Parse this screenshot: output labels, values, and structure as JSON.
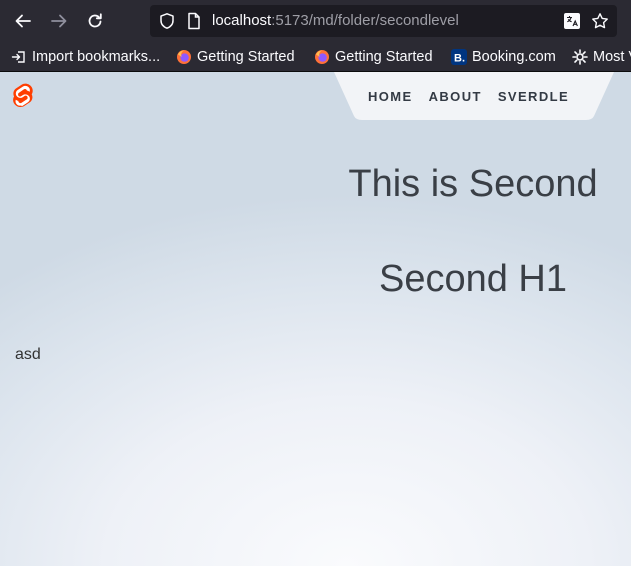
{
  "browser": {
    "url_host": "localhost",
    "url_path": ":5173/md/folder/secondlevel",
    "icons": [
      "back-arrow-icon",
      "forward-arrow-icon",
      "reload-icon",
      "shield-icon",
      "page-icon",
      "translate-icon",
      "star-icon"
    ],
    "bookmarks": [
      {
        "label": "Import bookmarks...",
        "icon": "import-icon"
      },
      {
        "label": "Getting Started",
        "icon": "firefox-icon"
      },
      {
        "label": "Getting Started",
        "icon": "firefox-icon"
      },
      {
        "label": "Booking.com",
        "icon": "booking-icon"
      },
      {
        "label": "Most V",
        "icon": "gear-icon"
      }
    ]
  },
  "site": {
    "logo": "svelte-logo-icon",
    "nav": [
      {
        "label": "HOME"
      },
      {
        "label": "ABOUT"
      },
      {
        "label": "SVERDLE"
      }
    ],
    "heading": "This is Second",
    "h1": "Second H1",
    "paragraph": "asd"
  },
  "colors": {
    "toolbar_bg": "#2b2a33",
    "urlbar_bg": "#1c1b22",
    "svelte_orange": "#ff3e00",
    "nav_bg": "#f2f4f7",
    "text_dark": "#3a3f46"
  }
}
